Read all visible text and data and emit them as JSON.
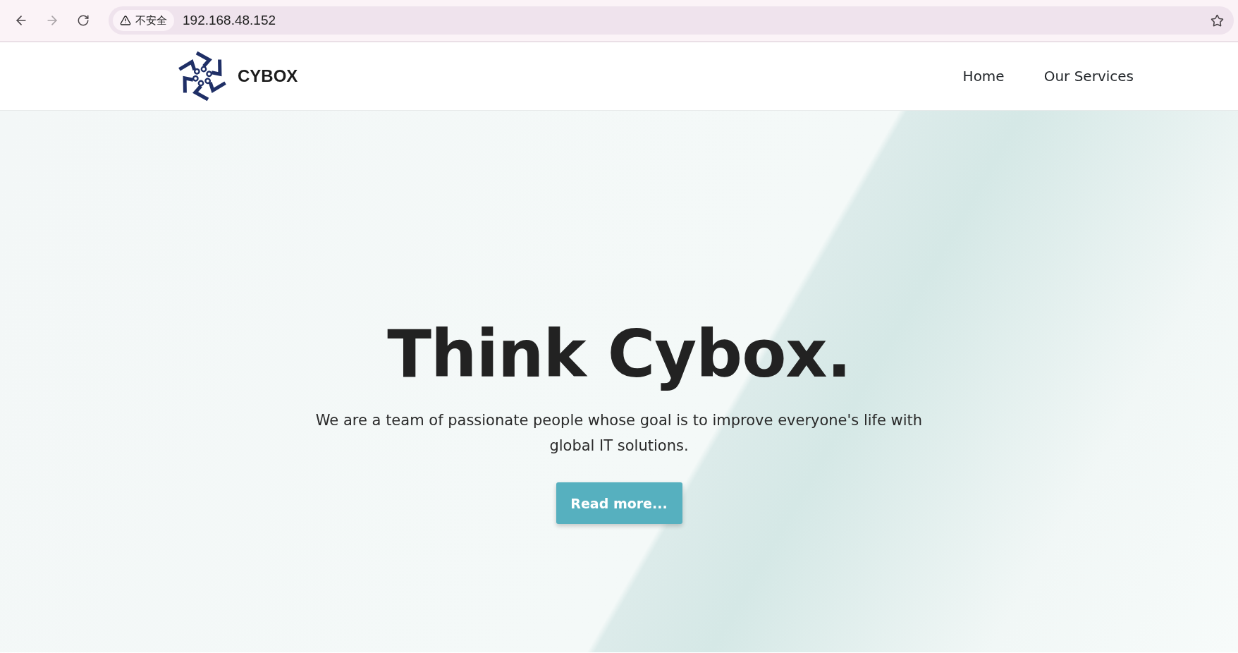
{
  "browser": {
    "security_label": "不安全",
    "url": "192.168.48.152"
  },
  "navbar": {
    "brand": "CYBOX",
    "links": [
      {
        "label": "Home"
      },
      {
        "label": "Our Services"
      }
    ]
  },
  "hero": {
    "title": "Think Cybox.",
    "subtitle": "We are a team of passionate people whose goal is to improve everyone's life with global IT solutions.",
    "button": "Read more..."
  }
}
